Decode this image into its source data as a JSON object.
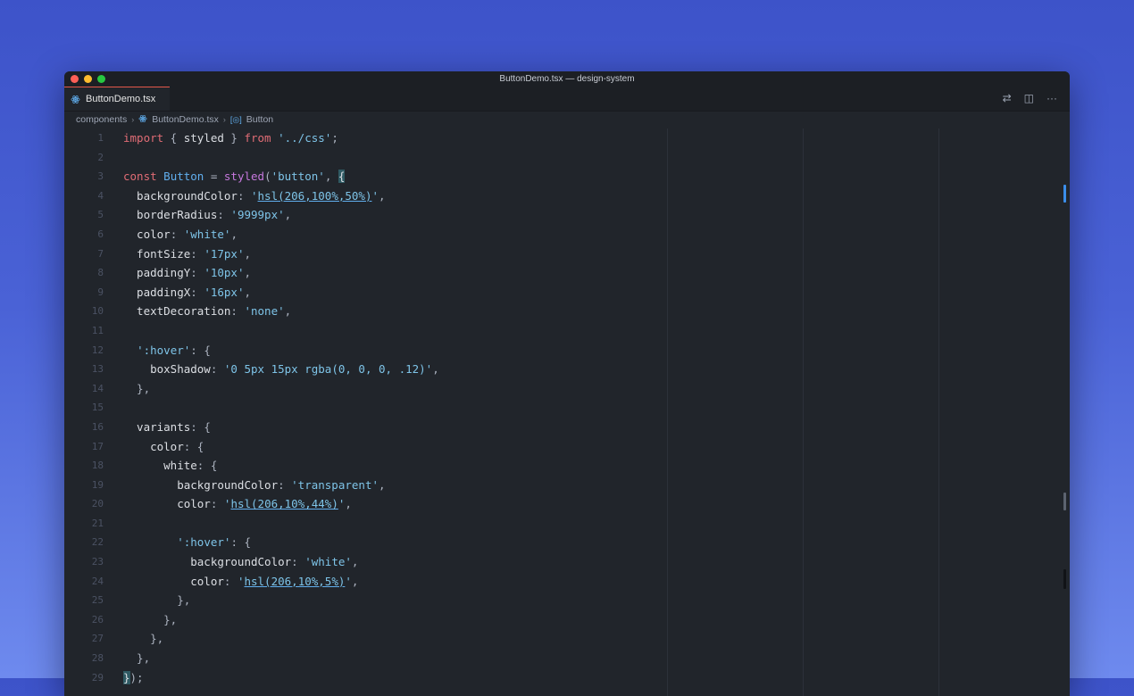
{
  "window": {
    "title": "ButtonDemo.tsx — design-system"
  },
  "tab": {
    "label": "ButtonDemo.tsx",
    "icon": "react-icon"
  },
  "tab_actions": [
    {
      "name": "source-control-icon",
      "glyph": "⇄"
    },
    {
      "name": "split-editor-icon",
      "glyph": "◫"
    },
    {
      "name": "more-actions-icon",
      "glyph": "···"
    }
  ],
  "breadcrumb": {
    "folder": "components",
    "file": "ButtonDemo.tsx",
    "symbol": "Button"
  },
  "code_lines": [
    {
      "n": "1",
      "t": [
        [
          "kw",
          "import"
        ],
        [
          "pun",
          " { "
        ],
        [
          "prop",
          "styled"
        ],
        [
          "pun",
          " } "
        ],
        [
          "kw",
          "from"
        ],
        [
          "pun",
          " "
        ],
        [
          "strb",
          "'../css'"
        ],
        [
          "pun",
          ";"
        ]
      ]
    },
    {
      "n": "2",
      "t": []
    },
    {
      "n": "3",
      "t": [
        [
          "kw",
          "const"
        ],
        [
          "pun",
          " "
        ],
        [
          "fn",
          "Button"
        ],
        [
          "pun",
          " = "
        ],
        [
          "kw2",
          "styled"
        ],
        [
          "pun",
          "("
        ],
        [
          "strb",
          "'button'"
        ],
        [
          "pun",
          ", "
        ],
        [
          "brace",
          "{"
        ]
      ]
    },
    {
      "n": "4",
      "t": [
        [
          "prop",
          "  backgroundColor"
        ],
        [
          "pun",
          ": "
        ],
        [
          "strb",
          "'"
        ],
        [
          "ul",
          "hsl(206,100%,50%)"
        ],
        [
          "strb",
          "'"
        ],
        [
          "pun",
          ","
        ]
      ]
    },
    {
      "n": "5",
      "t": [
        [
          "prop",
          "  borderRadius"
        ],
        [
          "pun",
          ": "
        ],
        [
          "strb",
          "'9999px'"
        ],
        [
          "pun",
          ","
        ]
      ]
    },
    {
      "n": "6",
      "t": [
        [
          "prop",
          "  color"
        ],
        [
          "pun",
          ": "
        ],
        [
          "strb",
          "'white'"
        ],
        [
          "pun",
          ","
        ]
      ]
    },
    {
      "n": "7",
      "t": [
        [
          "prop",
          "  fontSize"
        ],
        [
          "pun",
          ": "
        ],
        [
          "strb",
          "'17px'"
        ],
        [
          "pun",
          ","
        ]
      ]
    },
    {
      "n": "8",
      "t": [
        [
          "prop",
          "  paddingY"
        ],
        [
          "pun",
          ": "
        ],
        [
          "strb",
          "'10px'"
        ],
        [
          "pun",
          ","
        ]
      ]
    },
    {
      "n": "9",
      "t": [
        [
          "prop",
          "  paddingX"
        ],
        [
          "pun",
          ": "
        ],
        [
          "strb",
          "'16px'"
        ],
        [
          "pun",
          ","
        ]
      ]
    },
    {
      "n": "10",
      "t": [
        [
          "prop",
          "  textDecoration"
        ],
        [
          "pun",
          ": "
        ],
        [
          "strb",
          "'none'"
        ],
        [
          "pun",
          ","
        ]
      ]
    },
    {
      "n": "11",
      "t": []
    },
    {
      "n": "12",
      "t": [
        [
          "pun",
          "  "
        ],
        [
          "strb",
          "':hover'"
        ],
        [
          "pun",
          ": {"
        ]
      ]
    },
    {
      "n": "13",
      "t": [
        [
          "prop",
          "    boxShadow"
        ],
        [
          "pun",
          ": "
        ],
        [
          "strb",
          "'0 5px 15px rgba(0, 0, 0, .12)'"
        ],
        [
          "pun",
          ","
        ]
      ]
    },
    {
      "n": "14",
      "t": [
        [
          "pun",
          "  },"
        ]
      ]
    },
    {
      "n": "15",
      "t": []
    },
    {
      "n": "16",
      "t": [
        [
          "prop",
          "  variants"
        ],
        [
          "pun",
          ": {"
        ]
      ]
    },
    {
      "n": "17",
      "t": [
        [
          "prop",
          "    color"
        ],
        [
          "pun",
          ": {"
        ]
      ]
    },
    {
      "n": "18",
      "t": [
        [
          "prop",
          "      white"
        ],
        [
          "pun",
          ": {"
        ]
      ]
    },
    {
      "n": "19",
      "t": [
        [
          "prop",
          "        backgroundColor"
        ],
        [
          "pun",
          ": "
        ],
        [
          "strb",
          "'transparent'"
        ],
        [
          "pun",
          ","
        ]
      ]
    },
    {
      "n": "20",
      "t": [
        [
          "prop",
          "        color"
        ],
        [
          "pun",
          ": "
        ],
        [
          "strb",
          "'"
        ],
        [
          "ul",
          "hsl(206,10%,44%)"
        ],
        [
          "strb",
          "'"
        ],
        [
          "pun",
          ","
        ]
      ]
    },
    {
      "n": "21",
      "t": []
    },
    {
      "n": "22",
      "t": [
        [
          "pun",
          "        "
        ],
        [
          "strb",
          "':hover'"
        ],
        [
          "pun",
          ": {"
        ]
      ]
    },
    {
      "n": "23",
      "t": [
        [
          "prop",
          "          backgroundColor"
        ],
        [
          "pun",
          ": "
        ],
        [
          "strb",
          "'white'"
        ],
        [
          "pun",
          ","
        ]
      ]
    },
    {
      "n": "24",
      "t": [
        [
          "prop",
          "          color"
        ],
        [
          "pun",
          ": "
        ],
        [
          "strb",
          "'"
        ],
        [
          "ul",
          "hsl(206,10%,5%)"
        ],
        [
          "strb",
          "'"
        ],
        [
          "pun",
          ","
        ]
      ]
    },
    {
      "n": "25",
      "t": [
        [
          "pun",
          "        },"
        ]
      ]
    },
    {
      "n": "26",
      "t": [
        [
          "pun",
          "      },"
        ]
      ]
    },
    {
      "n": "27",
      "t": [
        [
          "pun",
          "    },"
        ]
      ]
    },
    {
      "n": "28",
      "t": [
        [
          "pun",
          "  },"
        ]
      ]
    },
    {
      "n": "29",
      "t": [
        [
          "brace",
          "}"
        ],
        [
          "pun",
          ");"
        ]
      ]
    }
  ],
  "colors": {
    "accent": "#61afef",
    "tab_border": "#e4584b",
    "editor_bg": "#21252b"
  }
}
